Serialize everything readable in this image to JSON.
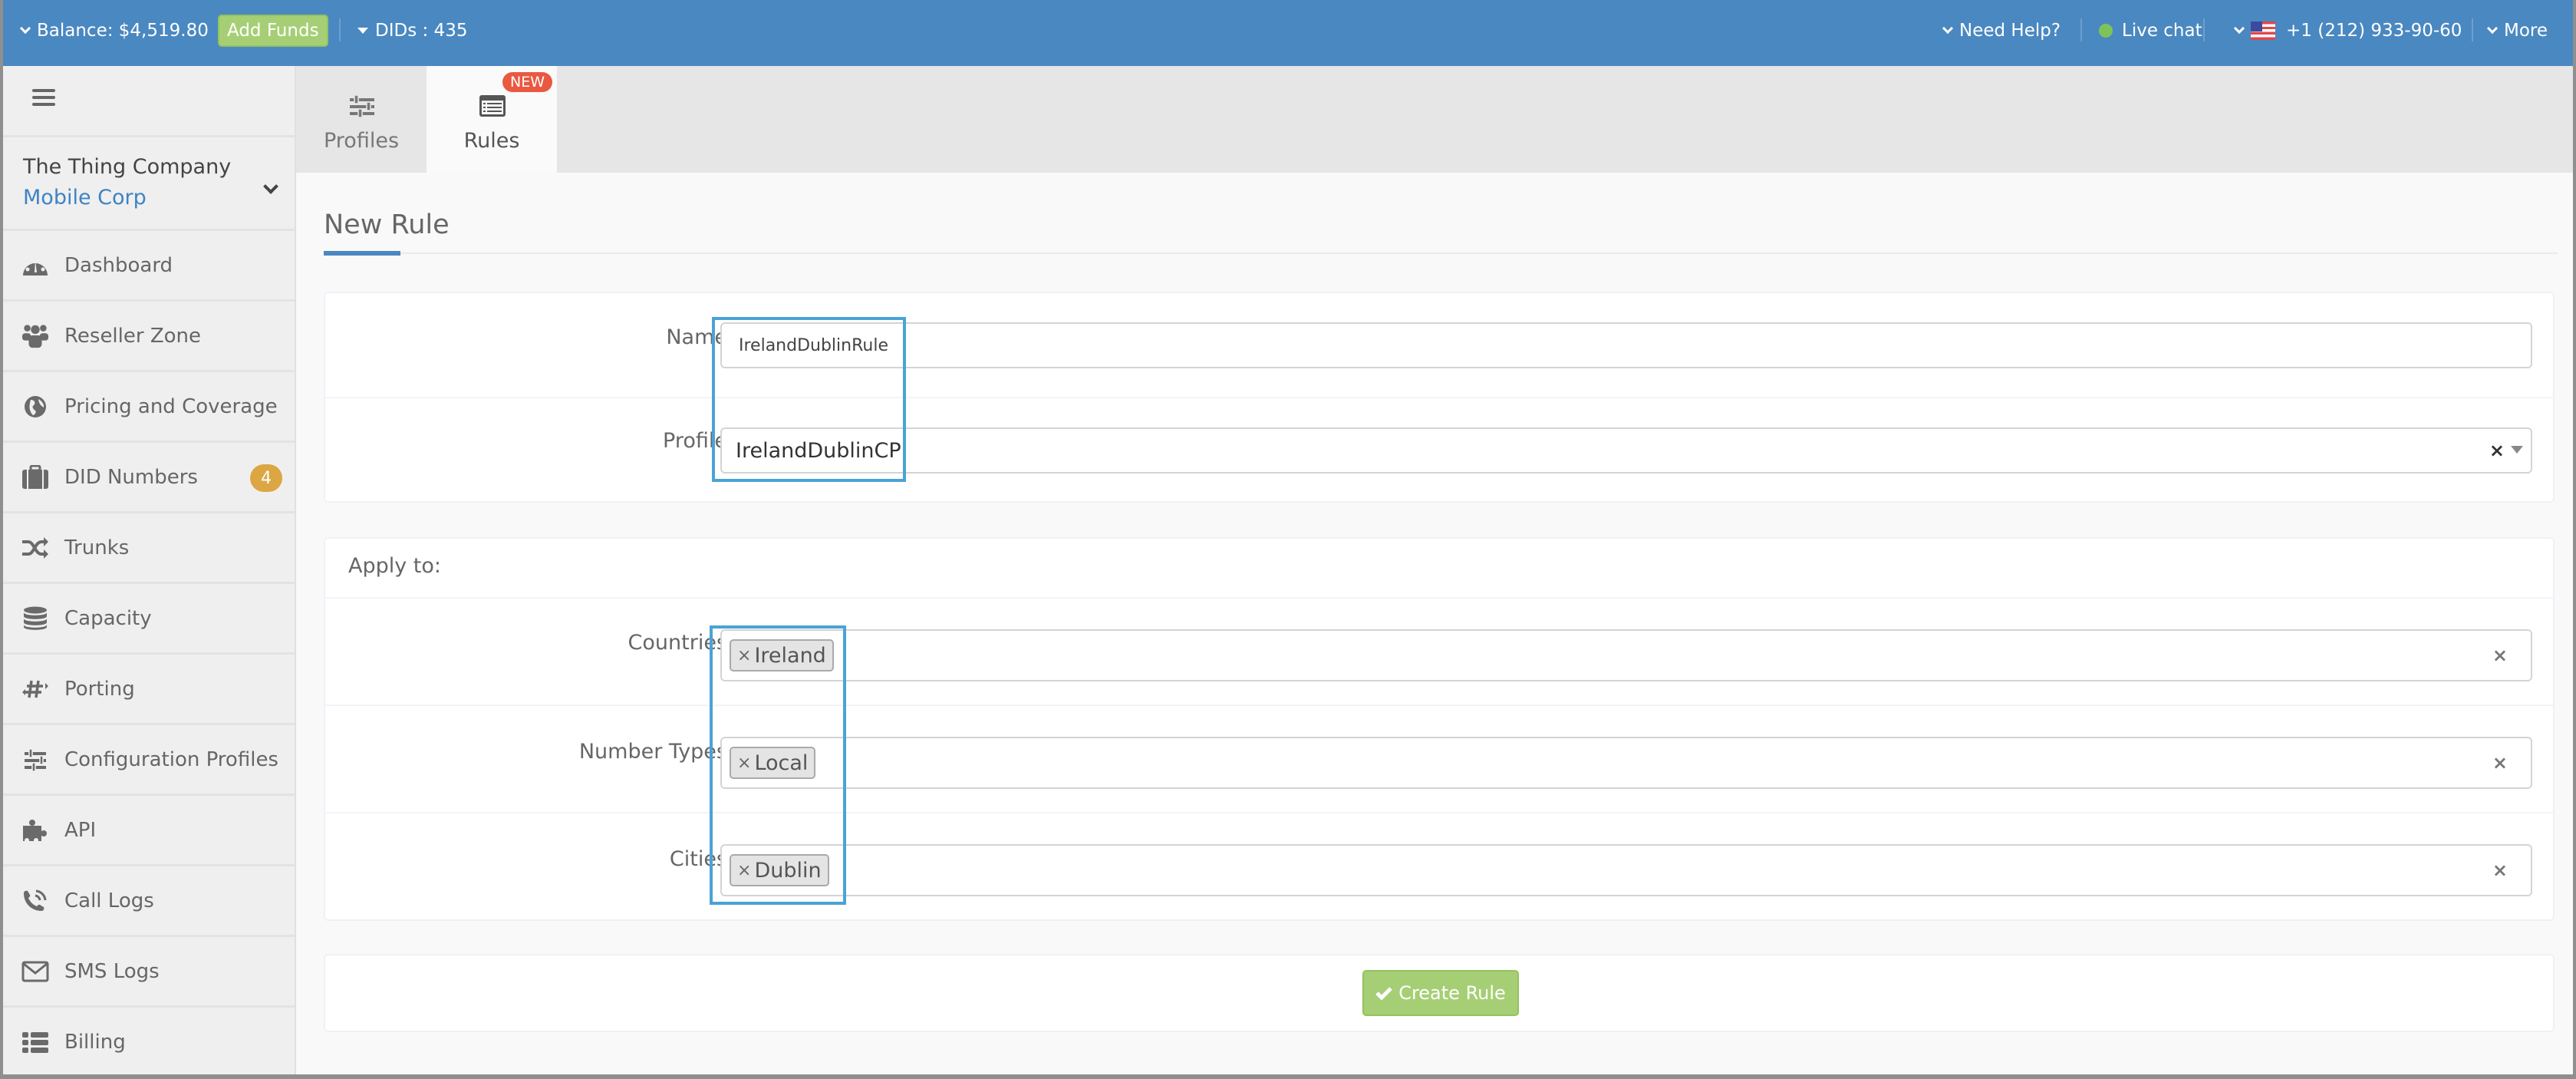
{
  "topbar": {
    "balance": "Balance: $4,519.80",
    "add_funds": "Add Funds",
    "dids": "DIDs : 435",
    "need_help": "Need Help?",
    "live_chat": "Live chat",
    "phone": "+1 (212) 933-90-60",
    "more": "More",
    "colors": {
      "bar": "#4a88c1",
      "add_funds": "#a6cf75",
      "live_dot": "#7dc35a"
    }
  },
  "sidebar": {
    "company_name": "The Thing Company",
    "company_sub": "Mobile Corp",
    "items": [
      {
        "label": "Dashboard",
        "icon": "dashboard-icon"
      },
      {
        "label": "Reseller Zone",
        "icon": "users-icon"
      },
      {
        "label": "Pricing and Coverage",
        "icon": "globe-icon"
      },
      {
        "label": "DID Numbers",
        "icon": "briefcase-icon",
        "badge": "4"
      },
      {
        "label": "Trunks",
        "icon": "shuffle-icon"
      },
      {
        "label": "Capacity",
        "icon": "database-icon"
      },
      {
        "label": "Porting",
        "icon": "hash-arrows-icon"
      },
      {
        "label": "Configuration Profiles",
        "icon": "sliders-icon"
      },
      {
        "label": "API",
        "icon": "puzzle-icon"
      },
      {
        "label": "Call Logs",
        "icon": "phone-volume-icon"
      },
      {
        "label": "SMS Logs",
        "icon": "envelope-icon"
      },
      {
        "label": "Billing",
        "icon": "list-icon"
      }
    ]
  },
  "tabs": [
    {
      "label": "Profiles",
      "active": false
    },
    {
      "label": "Rules",
      "active": true,
      "badge": "NEW"
    }
  ],
  "page": {
    "title": "New Rule",
    "form": {
      "name_label": "Name",
      "name_value": "IrelandDublinRule",
      "profile_label": "Profile",
      "profile_value": "IrelandDublinCP",
      "apply_to_label": "Apply to:",
      "countries_label": "Countries",
      "countries": [
        "Ireland"
      ],
      "number_types_label": "Number Types",
      "number_types": [
        "Local"
      ],
      "cities_label": "Cities",
      "cities": [
        "Dublin"
      ],
      "tag_remove": "×",
      "clear": "×"
    },
    "create_button": "Create Rule"
  }
}
